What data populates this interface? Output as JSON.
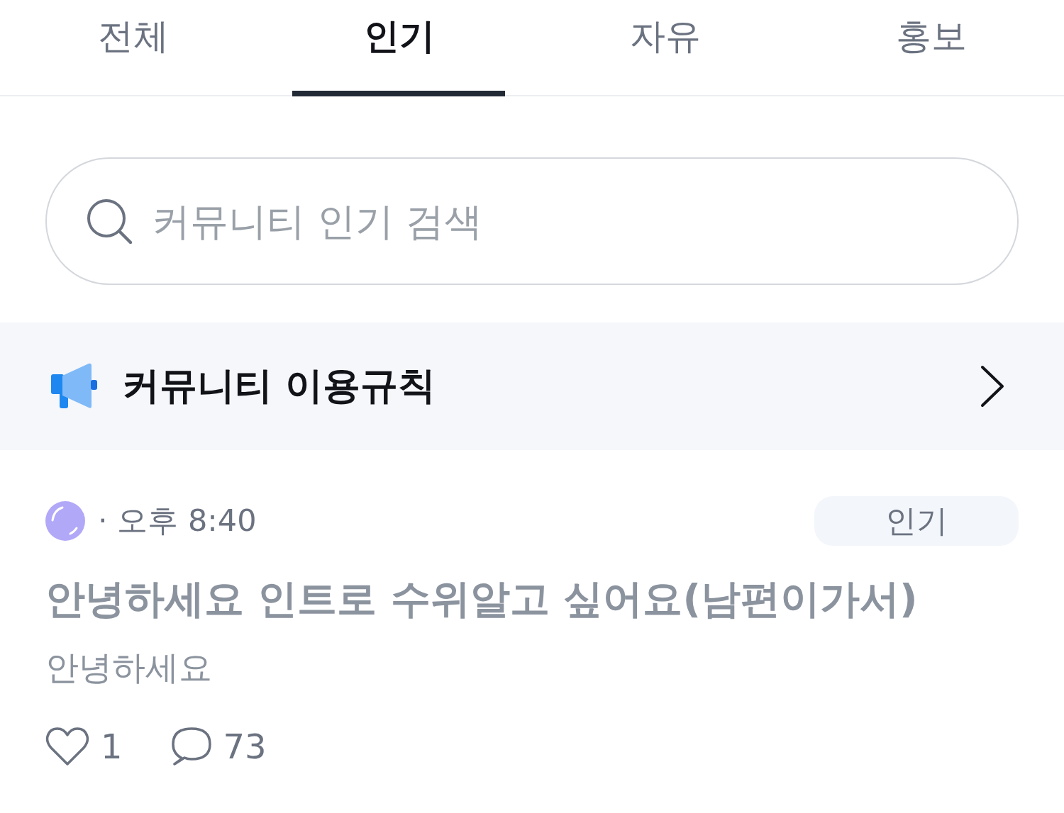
{
  "tabs": [
    {
      "label": "전체",
      "selected": false
    },
    {
      "label": "인기",
      "selected": true
    },
    {
      "label": "자유",
      "selected": false
    },
    {
      "label": "홍보",
      "selected": false
    }
  ],
  "search": {
    "placeholder": "커뮤니티 인기 검색"
  },
  "notice": {
    "label": "커뮤니티 이용규칙"
  },
  "post": {
    "time": "· 오후 8:40",
    "category": "인기",
    "title": "안녕하세요 인트로 수위알고 싶어요(남편이가서)",
    "read": true,
    "excerpt": "안녕하세요",
    "likes": "1",
    "comments": "73"
  }
}
